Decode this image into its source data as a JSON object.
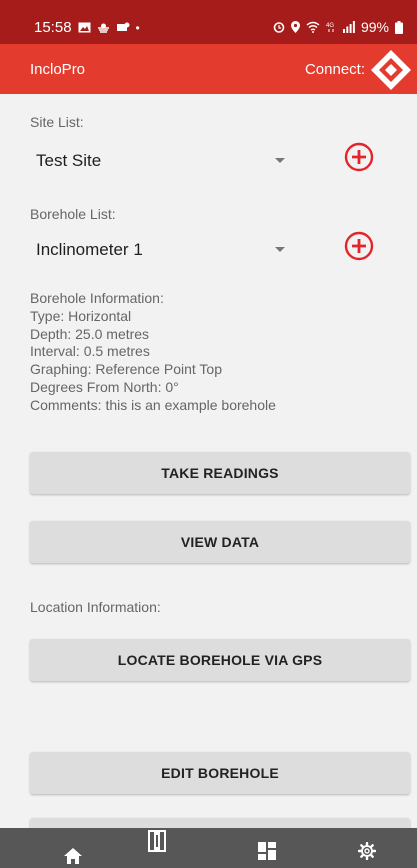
{
  "status_bar": {
    "time": "15:58",
    "left_icons": [
      "gallery-icon",
      "weather-icon",
      "notification-icon",
      "dot-icon"
    ],
    "right_icons": [
      "alarm-icon",
      "location-icon",
      "wifi-icon",
      "4g-icon",
      "signal-icon"
    ],
    "battery": "99%"
  },
  "app_bar": {
    "title": "IncloPro",
    "connect_label": "Connect:",
    "connect_icon": "bluetooth-diamond-icon"
  },
  "site": {
    "label": "Site List:",
    "selected": "Test Site",
    "add_icon": "add-circle-icon"
  },
  "borehole": {
    "label": "Borehole List:",
    "selected": "Inclinometer 1",
    "add_icon": "add-circle-icon"
  },
  "borehole_info": {
    "heading": "Borehole Information:",
    "type": "Type: Horizontal",
    "depth": "Depth: 25.0 metres",
    "interval": "Interval: 0.5 metres",
    "graphing": "Graphing: Reference Point Top",
    "degrees": "Degrees From North: 0°",
    "comments": "Comments: this is an example borehole"
  },
  "buttons": {
    "take_readings": "TAKE READINGS",
    "view_data": "VIEW DATA",
    "locate_gps": "LOCATE BOREHOLE VIA GPS",
    "edit_borehole": "EDIT BOREHOLE"
  },
  "location_label": "Location Information:",
  "bottom_nav": [
    {
      "icon": "home-icon"
    },
    {
      "icon": "borehole-icon"
    },
    {
      "icon": "dashboard-icon"
    },
    {
      "icon": "settings-icon"
    }
  ],
  "colors": {
    "status_bar": "#a51c1a",
    "app_bar": "#e33b2e",
    "accent": "#e3252b",
    "button_bg": "#dddddd",
    "nav_bg": "#575757"
  }
}
